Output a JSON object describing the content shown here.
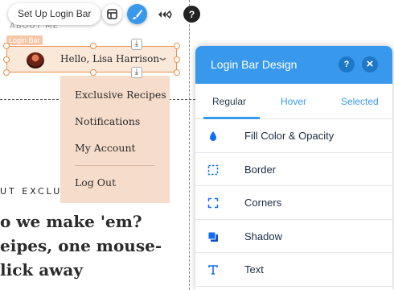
{
  "toolbar": {
    "label": "Set Up Login Bar",
    "buttons": [
      {
        "name": "layout-icon"
      },
      {
        "name": "design-brush-icon",
        "active": true
      },
      {
        "name": "animation-icon"
      }
    ],
    "help": "?"
  },
  "site": {
    "about_label": "ABOUT ME",
    "login_bar_tag": "Login Bar",
    "greeting": "Hello, Lisa Harrison",
    "menu_items": [
      "Exclusive Recipes",
      "Notifications",
      "My Account",
      "Log Out"
    ],
    "section_heading": "UT EXCLU",
    "headline_lines": [
      "o we make 'em?",
      "eipes, one mouse-",
      "lick away"
    ]
  },
  "panel": {
    "title": "Login Bar Design",
    "help": "?",
    "close": "×",
    "tabs": [
      "Regular",
      "Hover",
      "Selected"
    ],
    "active_tab": "Regular",
    "options": [
      {
        "label": "Fill Color & Opacity",
        "icon": "fill-drop-icon"
      },
      {
        "label": "Border",
        "icon": "border-icon"
      },
      {
        "label": "Corners",
        "icon": "corners-icon"
      },
      {
        "label": "Shadow",
        "icon": "shadow-icon"
      },
      {
        "label": "Text",
        "icon": "text-icon"
      }
    ]
  },
  "colors": {
    "accent": "#3899ec",
    "selection": "#ee8f4c",
    "menu_bg": "#f6dccb",
    "bar_bg": "#fae8d9"
  }
}
